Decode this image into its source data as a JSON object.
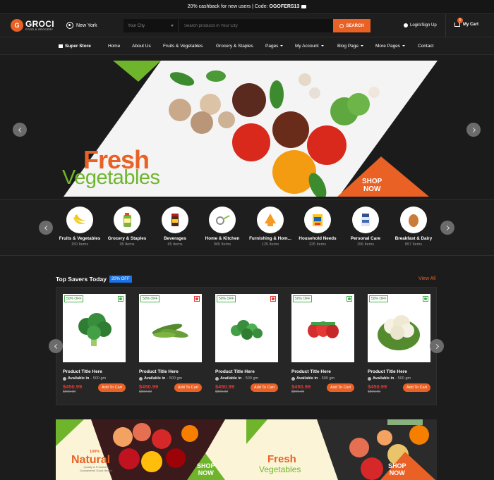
{
  "topbar": {
    "text": "20% cashback for new users | Code:",
    "code": "OGOFERS13"
  },
  "header": {
    "logo_initial": "G",
    "logo_name": "GROCI",
    "logo_sub": "FOOD & GROCERY",
    "location": "New York",
    "city_placeholder": "Your City",
    "search_placeholder": "Search products in Your City",
    "search_button": "SEARCH",
    "login": "Login/Sign Up",
    "cart_label": "My Cart",
    "cart_count": "5"
  },
  "nav": {
    "store": "Super Store",
    "items": [
      "Home",
      "About Us",
      "Fruits & Vegetables",
      "Grocery & Staples",
      "Pages",
      "My Account",
      "Blog Page",
      "More Pages",
      "Contact"
    ]
  },
  "hero": {
    "title_1": "Fresh",
    "title_2": "Vegetables",
    "shop_1": "SHOP",
    "shop_2": "NOW"
  },
  "categories": [
    {
      "name": "Fruits & Vegetables",
      "count": "150 Items"
    },
    {
      "name": "Grocery & Staples",
      "count": "95 Items"
    },
    {
      "name": "Beverages",
      "count": "65 Items"
    },
    {
      "name": "Home & Kitchen",
      "count": "965 Items"
    },
    {
      "name": "Furnishing & Hom...",
      "count": "125 Items"
    },
    {
      "name": "Household Needs",
      "count": "325 Items"
    },
    {
      "name": "Personal Care",
      "count": "156 Items"
    },
    {
      "name": "Breakfast & Dairy",
      "count": "857 Items"
    }
  ],
  "savers": {
    "title": "Top Savers Today",
    "badge": "20% OFF",
    "view_all": "View All",
    "products": [
      {
        "badge": "50% OFF",
        "title": "Product Title Here",
        "available": "Available in",
        "weight": "- 500 gm",
        "price": "$450.99",
        "old": "$800.99",
        "button": "Add To Cart",
        "veg": "green"
      },
      {
        "badge": "50% OFF",
        "title": "Product Title Here",
        "available": "Available in",
        "weight": "- 500 gm",
        "price": "$450.99",
        "old": "$800.99",
        "button": "Add To Cart",
        "veg": "red"
      },
      {
        "badge": "50% OFF",
        "title": "Product Title Here",
        "available": "Available in",
        "weight": "- 500 gm",
        "price": "$450.99",
        "old": "$800.99",
        "button": "Add To Cart",
        "veg": "red"
      },
      {
        "badge": "50% OFF",
        "title": "Product Title Here",
        "available": "Available in",
        "weight": "- 500 gm",
        "price": "$450.99",
        "old": "$800.99",
        "button": "Add To Cart",
        "veg": "green"
      },
      {
        "badge": "50% OFF",
        "title": "Product Title Here",
        "available": "Available in",
        "weight": "- 500 gm",
        "price": "$450.99",
        "old": "$800.99",
        "button": "Add To Cart",
        "veg": "green"
      }
    ]
  },
  "banners": {
    "left": {
      "pct": "100%",
      "word": "Natural",
      "tag_1": "Quality & Freshness",
      "tag_2": "Guaranteed! Good Health.",
      "shop_1": "SHOP",
      "shop_2": "NOW"
    },
    "right": {
      "title_1": "Fresh",
      "title_2": "Vegetables",
      "shop_1": "SHOP",
      "shop_2": "NOW"
    }
  },
  "colors": {
    "accent": "#e96125",
    "green": "#6fb52c",
    "badge_blue": "#1a73e8",
    "bg": "#1c1c1c"
  }
}
